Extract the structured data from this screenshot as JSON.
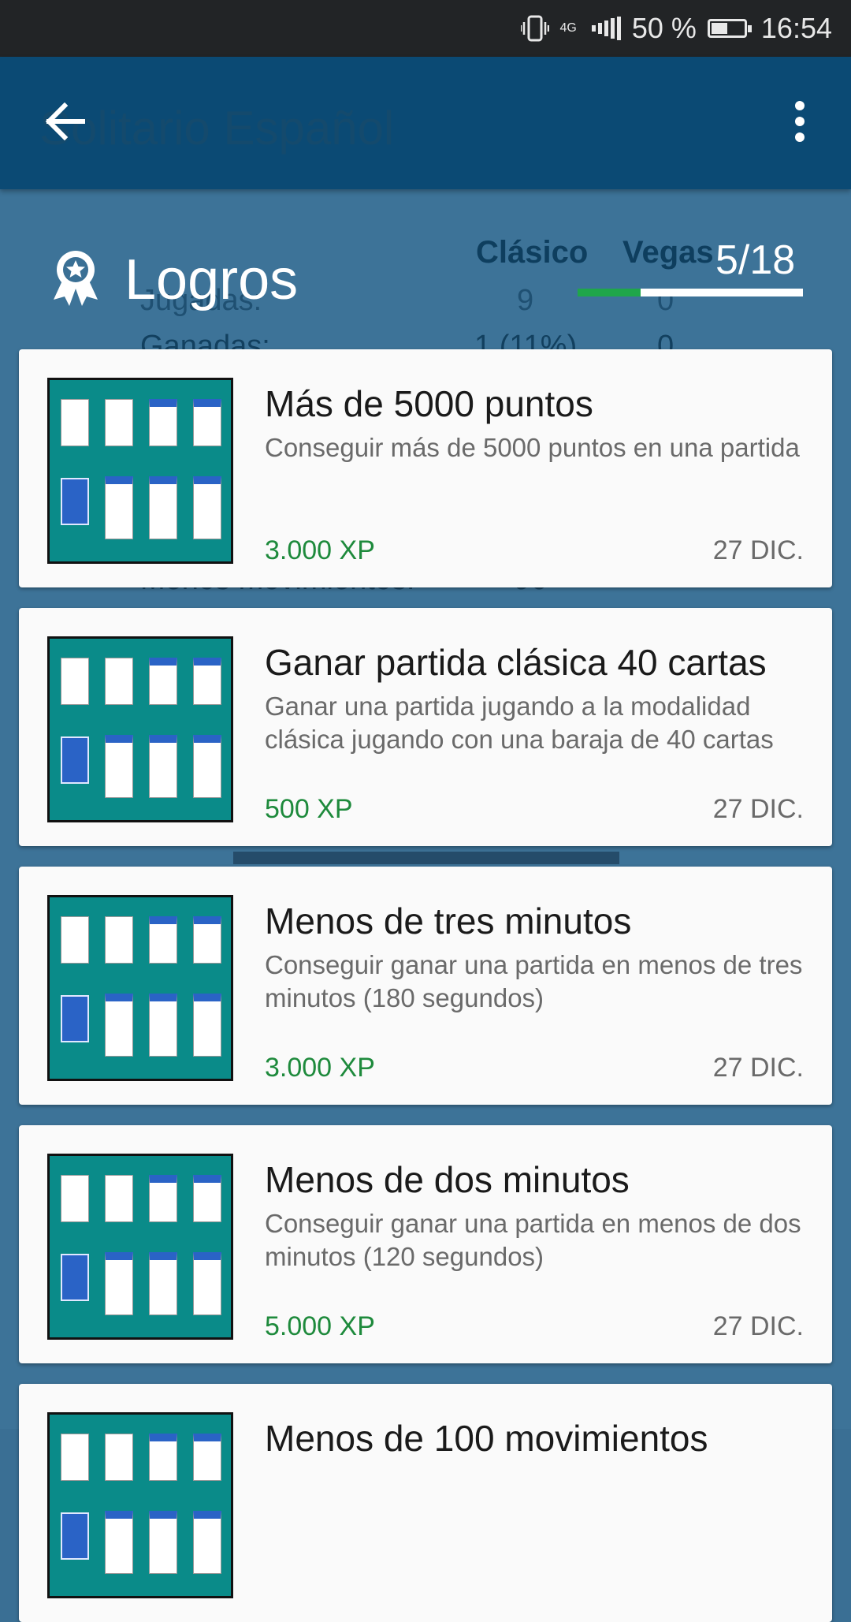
{
  "status_bar": {
    "network": "4G",
    "battery_percent": "50 %",
    "battery_level": 0.5,
    "time": "16:54"
  },
  "app_bar": {
    "title": "Solitario Español",
    "back_icon": "arrow-left-icon",
    "menu_icon": "more-vert-icon"
  },
  "background_stats": {
    "columns": [
      "Clásico",
      "Vegas"
    ],
    "rows": [
      {
        "label": "Jugadas:",
        "clasico": "9",
        "vegas": "0"
      },
      {
        "label": "Ganadas:",
        "clasico": "1 (11%)",
        "vegas": "0"
      },
      {
        "label": "Menos movimientos:",
        "clasico": "96",
        "vegas": ""
      }
    ]
  },
  "achievements": {
    "icon": "award-medal-icon",
    "title": "Logros",
    "progress_text": "5/18",
    "progress_fraction": 0.28,
    "colors": {
      "progress_fill": "#1fa64a",
      "xp_text": "#1e8a3c",
      "table_green": "#0a8b89",
      "card_back_blue": "#2a63c6"
    },
    "items": [
      {
        "title": "Más de 5000 puntos",
        "description": "Conseguir más de 5000 puntos en una partida",
        "xp": "3.000 XP",
        "date": "27 DIC."
      },
      {
        "title": "Ganar partida clásica 40 cartas",
        "description": "Ganar una partida jugando a la modalidad clásica jugando con una baraja de 40 cartas",
        "xp": "500 XP",
        "date": "27 DIC."
      },
      {
        "title": "Menos de tres minutos",
        "description": "Conseguir ganar una partida en menos de tres minutos (180 segundos)",
        "xp": "3.000 XP",
        "date": "27 DIC."
      },
      {
        "title": "Menos de dos minutos",
        "description": "Conseguir ganar una partida en menos de dos minutos (120 segundos)",
        "xp": "5.000 XP",
        "date": "27 DIC."
      },
      {
        "title": "Menos de 100 movimientos",
        "description": "",
        "xp": "",
        "date": ""
      }
    ]
  }
}
